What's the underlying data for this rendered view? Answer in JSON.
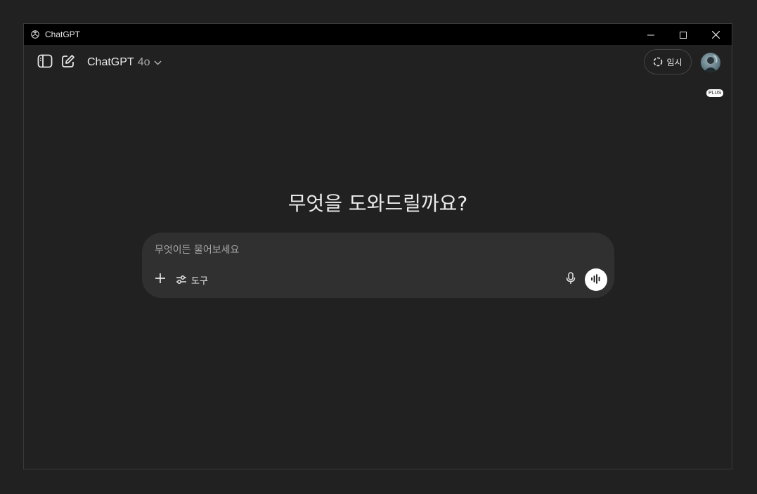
{
  "window": {
    "title": "ChatGPT",
    "controls": [
      "minimize-icon",
      "maximize-icon",
      "close-icon"
    ]
  },
  "header": {
    "sidebar_toggle_icon": "sidebar-icon",
    "new_chat_icon": "edit-icon",
    "model_name": "ChatGPT",
    "model_version": "4o",
    "model_chevron_icon": "chevron-down-icon",
    "temporary_chat_label": "임시",
    "temporary_chat_icon": "dashed-circle-icon",
    "plan_badge": "PLUS"
  },
  "main": {
    "headline": "무엇을 도와드릴까요?"
  },
  "composer": {
    "placeholder": "무엇이든 물어보세요",
    "add_icon": "plus-icon",
    "tools_label": "도구",
    "tools_icon": "sliders-icon",
    "mic_icon": "microphone-icon",
    "voice_icon": "voice-waveform-icon"
  },
  "colors": {
    "background": "#212121",
    "titlebar": "#000000",
    "composer": "#303030",
    "text": "#ececec",
    "muted_text": "#a6a6a6",
    "voice_button": "#ffffff"
  }
}
